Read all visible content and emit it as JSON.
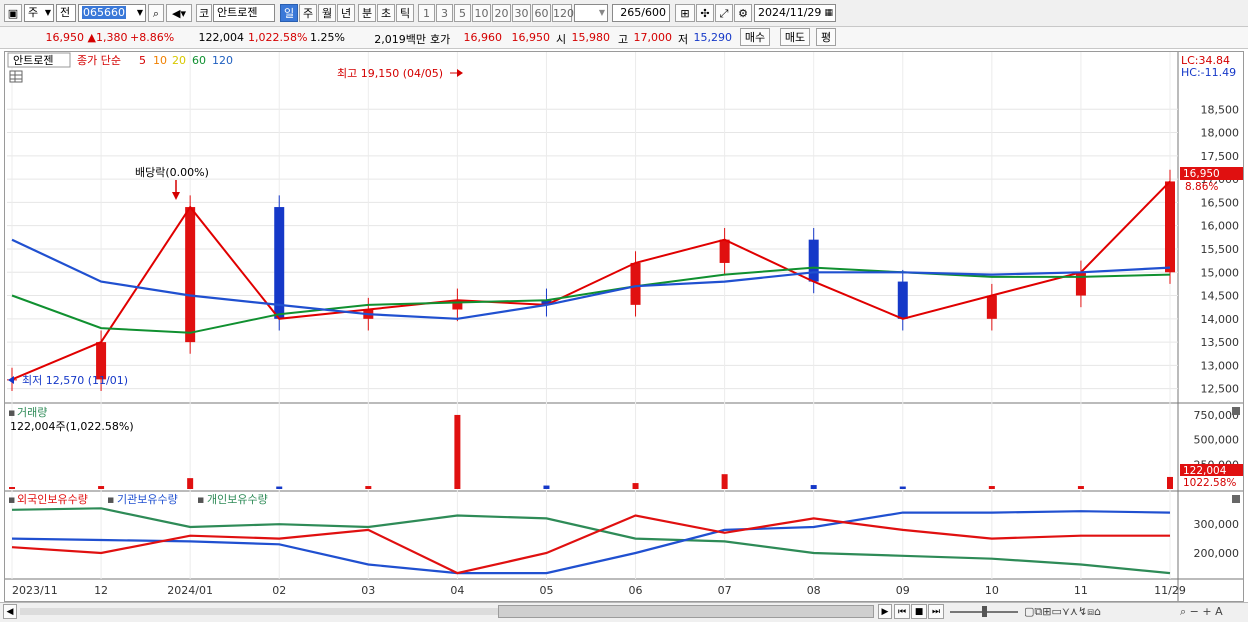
{
  "toolbar": {
    "market_combo": "주",
    "prev_label": "전",
    "code_value": "065660",
    "market_badge": "코",
    "stock_name": "안트로젠",
    "periods": [
      "일",
      "주",
      "월",
      "년",
      "분",
      "초",
      "틱"
    ],
    "selected_period": "일",
    "intervals": [
      "1",
      "3",
      "5",
      "10",
      "20",
      "30",
      "60",
      "120"
    ],
    "count_value": "265",
    "count_total": "/600",
    "date_value": "2024/11/29"
  },
  "quote": {
    "price": "16,950",
    "direction_arrow": "▲",
    "change": "1,380",
    "change_pct": "+8.86%",
    "volume": "122,004",
    "volume_pct": "1,022.58%",
    "turnover_pct": "1.25%",
    "amount": "2,019백만",
    "ask_label": "호가",
    "ask_value": "16,960",
    "bid_value": "16,950",
    "open_label": "시",
    "open_value": "15,980",
    "high_label": "고",
    "high_value": "17,000",
    "low_label": "저",
    "low_value": "15,290",
    "buy_label": "매수",
    "sell_label": "매도",
    "avg_label": "평"
  },
  "colors": {
    "candle_up": "#e01010",
    "candle_down": "#1538c8",
    "ma5": "#e00000",
    "ma10": "#f08000",
    "ma20": "#f0e000",
    "ma60": "#109030",
    "ma120": "#2050d0",
    "foreign": "#e01010",
    "institution": "#2050d0",
    "individual": "#2e8b57"
  },
  "price_panel": {
    "name_tag": "안트로젠",
    "legend_label": "종가 단순",
    "legend_periods": [
      "5",
      "10",
      "20",
      "60",
      "120"
    ],
    "high_marker": "최고 19,150 (04/05)",
    "low_marker": "최저 12,570 (11/01)",
    "dividend_marker": "배당락(0.00%)",
    "lc_label": "LC:34.84",
    "hc_label": "HC:-11.49",
    "current_tag": "16,950",
    "current_pct": "8.86%",
    "y_ticks": [
      "18,500",
      "18,000",
      "17,500",
      "17,000",
      "16,500",
      "16,000",
      "15,500",
      "15,000",
      "14,500",
      "14,000",
      "13,500",
      "13,000",
      "12,500"
    ]
  },
  "volume_panel": {
    "title": "거래량",
    "value_label": "122,004주(1,022.58%)",
    "y_ticks": [
      "750,000",
      "500,000",
      "250,000"
    ],
    "current_tag": "122,004",
    "current_pct": "1022.58%"
  },
  "holdings_panel": {
    "legend": [
      "외국인보유수량",
      "기관보유수량",
      "개인보유수량"
    ],
    "y_ticks": [
      "300,000",
      "200,000"
    ]
  },
  "x_axis": [
    "2023/11",
    "12",
    "2024/01",
    "02",
    "03",
    "04",
    "05",
    "06",
    "07",
    "08",
    "09",
    "10",
    "11",
    "11/29"
  ],
  "chart_data": {
    "type": "line",
    "series_note": "",
    "x": [
      "2023/11",
      "12",
      "2024/01",
      "02",
      "03",
      "04",
      "05",
      "06",
      "07",
      "08",
      "09",
      "10",
      "11",
      "11/29"
    ],
    "close": [
      12700,
      13500,
      16400,
      14000,
      14200,
      14400,
      14300,
      15200,
      15700,
      14800,
      14000,
      14500,
      15000,
      16950
    ],
    "ma120": [
      15700,
      14800,
      14500,
      14300,
      14100,
      14000,
      14300,
      14700,
      14800,
      15000,
      15000,
      14950,
      15000,
      15100
    ],
    "ma60": [
      14500,
      13800,
      13700,
      14100,
      14300,
      14350,
      14400,
      14700,
      14950,
      15100,
      15000,
      14900,
      14900,
      14950
    ],
    "price_ylim": [
      12300,
      19300
    ],
    "volume": [
      20000,
      30000,
      110000,
      25000,
      30000,
      750000,
      35000,
      60000,
      150000,
      40000,
      25000,
      30000,
      30000,
      122004
    ],
    "volume_ylim": [
      0,
      800000
    ],
    "foreign": [
      220000,
      200000,
      260000,
      250000,
      280000,
      130000,
      200000,
      330000,
      270000,
      320000,
      280000,
      250000,
      260000,
      260000
    ],
    "institution": [
      250000,
      245000,
      240000,
      230000,
      160000,
      130000,
      130000,
      200000,
      280000,
      290000,
      340000,
      340000,
      345000,
      340000
    ],
    "individual": [
      350000,
      355000,
      290000,
      300000,
      290000,
      330000,
      320000,
      250000,
      240000,
      200000,
      190000,
      180000,
      160000,
      130000
    ],
    "holdings_ylim": [
      120000,
      370000
    ]
  }
}
